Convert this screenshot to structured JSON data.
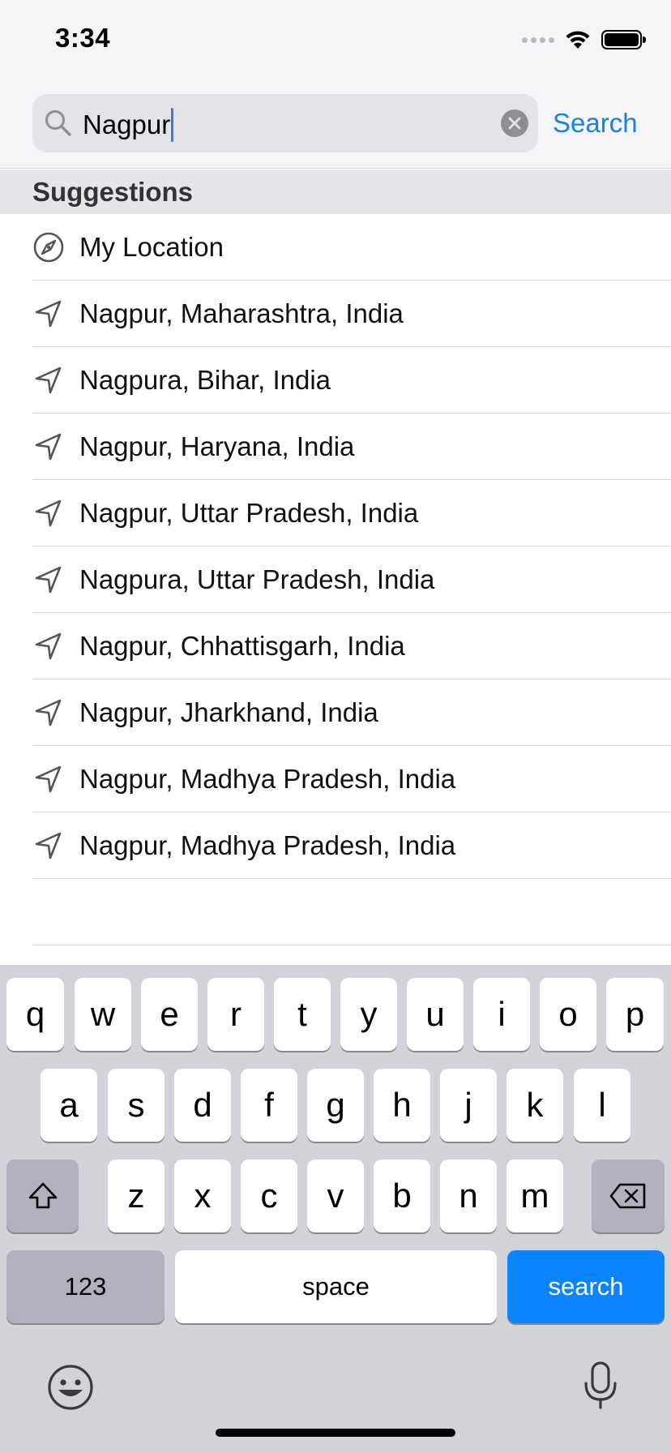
{
  "status_bar": {
    "time": "3:34"
  },
  "search": {
    "query": "Nagpur",
    "action_label": "Search"
  },
  "suggestions": {
    "header": "Suggestions",
    "items": [
      {
        "label": "My Location",
        "icon": "compass-icon"
      },
      {
        "label": "Nagpur, Maharashtra, India",
        "icon": "location-arrow-icon"
      },
      {
        "label": "Nagpura, Bihar, India",
        "icon": "location-arrow-icon"
      },
      {
        "label": "Nagpur, Haryana, India",
        "icon": "location-arrow-icon"
      },
      {
        "label": "Nagpur, Uttar Pradesh, India",
        "icon": "location-arrow-icon"
      },
      {
        "label": "Nagpura, Uttar Pradesh, India",
        "icon": "location-arrow-icon"
      },
      {
        "label": "Nagpur, Chhattisgarh, India",
        "icon": "location-arrow-icon"
      },
      {
        "label": "Nagpur, Jharkhand, India",
        "icon": "location-arrow-icon"
      },
      {
        "label": "Nagpur, Madhya Pradesh, India",
        "icon": "location-arrow-icon"
      },
      {
        "label": "Nagpur, Madhya Pradesh, India",
        "icon": "location-arrow-icon"
      }
    ]
  },
  "keyboard": {
    "row1": [
      "q",
      "w",
      "e",
      "r",
      "t",
      "y",
      "u",
      "i",
      "o",
      "p"
    ],
    "row2": [
      "a",
      "s",
      "d",
      "f",
      "g",
      "h",
      "j",
      "k",
      "l"
    ],
    "row3": [
      "z",
      "x",
      "c",
      "v",
      "b",
      "n",
      "m"
    ],
    "numbers_label": "123",
    "space_label": "space",
    "return_label": "search",
    "accent_color": "#0a84ff"
  }
}
